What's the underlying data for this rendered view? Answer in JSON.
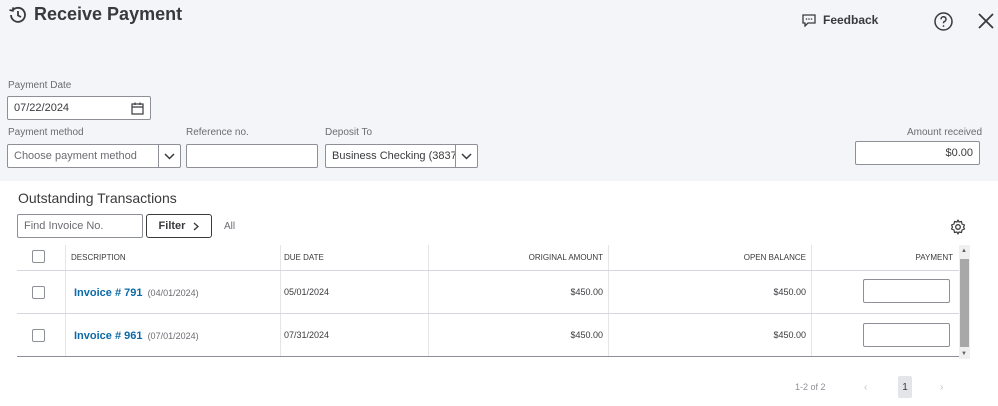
{
  "header": {
    "title": "Receive Payment",
    "feedback_label": "Feedback"
  },
  "form": {
    "payment_date_label": "Payment Date",
    "payment_date_value": "07/22/2024",
    "payment_method_label": "Payment method",
    "payment_method_placeholder": "Choose payment method",
    "reference_label": "Reference no.",
    "reference_value": "",
    "deposit_to_label": "Deposit To",
    "deposit_to_value": "Business Checking (3837)",
    "amount_received_label": "Amount received",
    "amount_received_value": "$0.00"
  },
  "transactions": {
    "section_title": "Outstanding Transactions",
    "find_placeholder": "Find Invoice No.",
    "filter_label": "Filter",
    "filter_state": "All",
    "columns": [
      "DESCRIPTION",
      "DUE DATE",
      "ORIGINAL AMOUNT",
      "OPEN BALANCE",
      "PAYMENT"
    ],
    "rows": [
      {
        "invoice": "Invoice # 791",
        "invoice_date": "(04/01/2024)",
        "due_date": "05/01/2024",
        "original_amount": "$450.00",
        "open_balance": "$450.00",
        "payment": ""
      },
      {
        "invoice": "Invoice # 961",
        "invoice_date": "(07/01/2024)",
        "due_date": "07/31/2024",
        "original_amount": "$450.00",
        "open_balance": "$450.00",
        "payment": ""
      }
    ]
  },
  "pager": {
    "info": "1-2 of 2",
    "prev": "‹",
    "current": "1",
    "next": "›"
  },
  "colors": {
    "link": "#0d6aa8",
    "panel_bg": "#f4f5f8"
  },
  "icons": [
    "history-icon",
    "feedback-icon",
    "help-icon",
    "close-icon",
    "calendar-icon",
    "chevron-down-icon",
    "chevron-right-icon",
    "gear-icon"
  ]
}
